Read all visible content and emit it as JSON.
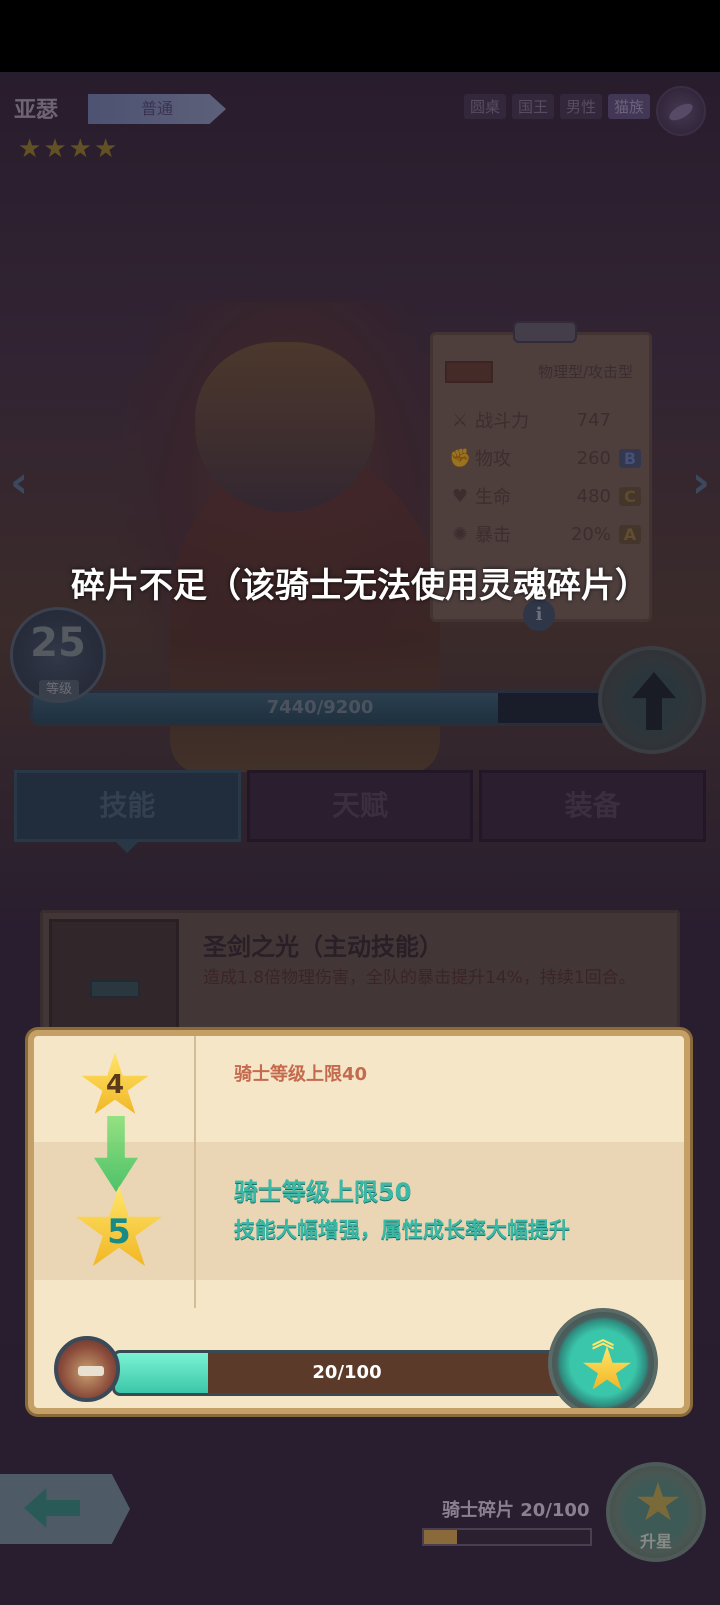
{
  "hero": {
    "name": "亚瑟",
    "rarity": "普通",
    "stars": 4,
    "tags": [
      "圆桌",
      "国王",
      "男性",
      "猫族"
    ]
  },
  "stats": {
    "type": "物理型/攻击型",
    "rows": [
      {
        "label": "战斗力",
        "value": "747",
        "grade": "",
        "icon": "crossed-swords-icon"
      },
      {
        "label": "物攻",
        "value": "260",
        "grade": "B",
        "icon": "fist-icon"
      },
      {
        "label": "生命",
        "value": "480",
        "grade": "C",
        "icon": "heart-icon"
      },
      {
        "label": "暴击",
        "value": "20%",
        "grade": "A",
        "icon": "crit-icon"
      }
    ]
  },
  "toast": "碎片不足（该骑士无法使用灵魂碎片）",
  "level": {
    "value": "25",
    "label": "等级",
    "exp_text": "7440/9200",
    "exp_fraction": 0.81
  },
  "tabs": [
    {
      "label": "技能",
      "active": true
    },
    {
      "label": "天赋",
      "active": false
    },
    {
      "label": "装备",
      "active": false
    }
  ],
  "skill": {
    "name": "圣剑之光（主动技能）",
    "description": "造成1.8倍物理伤害，全队的暴击提升14%，持续1回合。"
  },
  "star_up": {
    "from_star": "4",
    "to_star": "5",
    "current_limit": "骑士等级上限40",
    "new_limit": "骑士等级上限50",
    "new_desc": "技能大幅增强，属性成长率大幅提升",
    "shard_text": "20/100",
    "shard_fraction": 0.2
  },
  "footer": {
    "shard_label": "骑士碎片 20/100",
    "shard_fraction": 0.2,
    "star_up_label": "升星"
  }
}
